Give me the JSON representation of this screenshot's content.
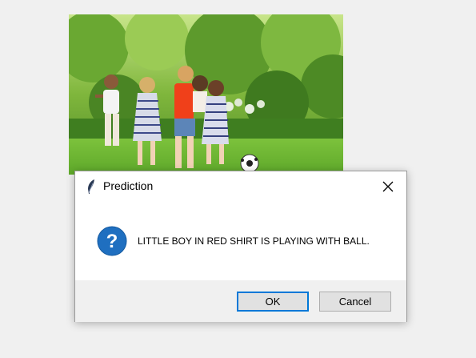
{
  "photo": {
    "icon": "children-playing-soccer-photo"
  },
  "dialog": {
    "title": "Prediction",
    "title_icon": "feather-icon",
    "close_icon": "close-icon",
    "message_icon": "question-icon",
    "message": "LITTLE BOY IN RED SHIRT IS PLAYING WITH BALL.",
    "buttons": {
      "ok_label": "OK",
      "cancel_label": "Cancel"
    }
  },
  "colors": {
    "accent": "#0078d7",
    "question_icon": "#1f6fc0",
    "window_bg": "#f0f0f0"
  }
}
